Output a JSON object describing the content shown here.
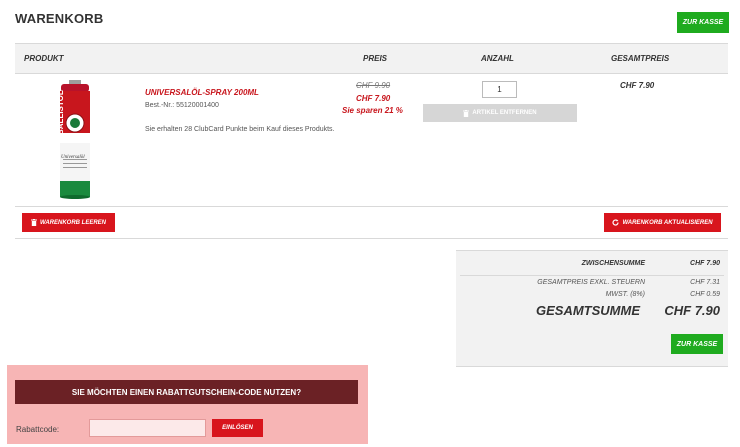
{
  "page": {
    "title": "WARENKORB"
  },
  "header": {
    "checkout_label": "ZUR KASSE"
  },
  "table": {
    "columns": {
      "product": "PRODUKT",
      "price": "PREIS",
      "qty": "ANZAHL",
      "total": "GESAMTPREIS"
    },
    "item": {
      "name": "UNIVERSALÖL-SPRAY 200ML",
      "sku": "Best.-Nr.: 55120001400",
      "note": "Sie erhalten 28 ClubCard Punkte beim Kauf dieses Produkts.",
      "image_text": "BALLISTOL",
      "image_subtext": "Universalöl",
      "price_old": "CHF 9.90",
      "price_new": "CHF 7.90",
      "price_saving": "Sie sparen 21 %",
      "quantity": "1",
      "remove_label": "ARTIKEL ENTFERNEN",
      "total": "CHF 7.90"
    }
  },
  "actions": {
    "empty_label": "WARENKORB LEEREN",
    "update_label": "WARENKORB AKTUALISIEREN"
  },
  "summary": {
    "subtotal_label": "ZWISCHENSUMME",
    "subtotal_value": "CHF 7.90",
    "net_label": "GESAMTPREIS EXKL. STEUERN",
    "net_value": "CHF 7.31",
    "tax_label": "MWST. (8%)",
    "tax_value": "CHF 0.59",
    "grand_label": "GESAMTSUMME",
    "grand_value": "CHF 7.90",
    "checkout_label": "ZUR KASSE"
  },
  "coupon": {
    "title": "SIE MÖCHTEN EINEN RABATTGUTSCHEIN-CODE NUTZEN?",
    "label": "Rabattcode:",
    "input_value": "",
    "redeem_label": "EINLÖSEN"
  },
  "colors": {
    "accent_red": "#d8151d",
    "accent_green": "#1fab1f",
    "coupon_bg": "#f7b5b5",
    "coupon_title_bg": "#6b2125"
  },
  "icons": {
    "remove": "trash-icon",
    "empty": "trash-icon",
    "update": "refresh-icon"
  }
}
